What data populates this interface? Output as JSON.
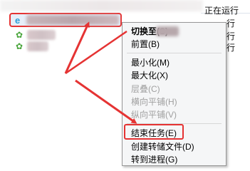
{
  "task_list": {
    "rows": [
      {
        "status": "正在运行"
      },
      {
        "status": "正在运行"
      },
      {
        "status": "正在运行"
      },
      {
        "status": "正在运行"
      }
    ]
  },
  "context_menu": {
    "items": [
      {
        "label": "切换至(S)",
        "style": "bold"
      },
      {
        "label": "前置(B)",
        "style": "normal"
      },
      {
        "label": "最小化(M)",
        "style": "normal"
      },
      {
        "label": "最大化(X)",
        "style": "normal"
      },
      {
        "label": "层叠(C)",
        "style": "disabled"
      },
      {
        "label": "横向平铺(H)",
        "style": "disabled"
      },
      {
        "label": "纵向平铺(V)",
        "style": "disabled"
      },
      {
        "label": "结束任务(E)",
        "style": "normal"
      },
      {
        "label": "创建转储文件(D)",
        "style": "normal"
      },
      {
        "label": "转到进程(G)",
        "style": "normal"
      }
    ]
  },
  "colors": {
    "annotation_red": "#e53333",
    "menu_background": "#f5f6f7"
  },
  "icons": [
    "app-icon",
    "ie-icon"
  ]
}
